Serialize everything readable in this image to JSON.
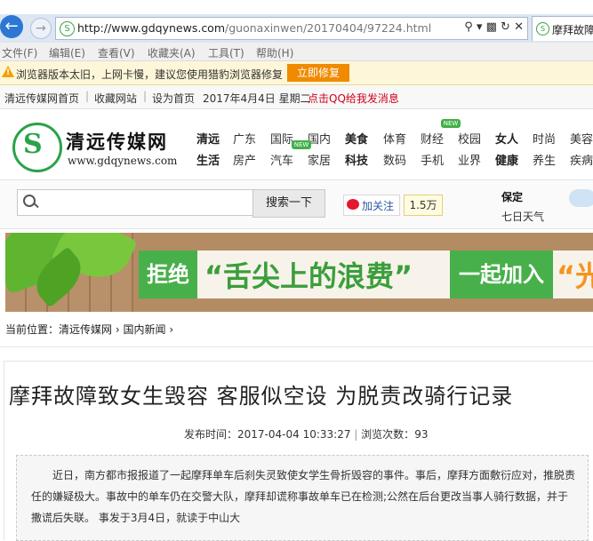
{
  "browser": {
    "url_host": "http://www.gdqynews.com",
    "url_path": "/guonaxinwen/20170404/97224.html",
    "tab_title": "摩拜故障",
    "menu": [
      "文件(F)",
      "编辑(E)",
      "查看(V)",
      "收藏夹(A)",
      "工具(T)",
      "帮助(H)"
    ],
    "warning_text": "浏览器版本太旧，上网卡慢，建议您使用猎豹浏览器修复",
    "repair_button": "立即修复"
  },
  "toplinks": {
    "home": "清远传媒网首页",
    "favorite": "收藏网站",
    "set_home": "设为首页",
    "date": "2017年4月4日 星期二",
    "qq_message": "点击QQ给我发消息"
  },
  "logo": {
    "name": "清远传媒网",
    "domain": "www.gdqynews.com"
  },
  "nav": {
    "row1": [
      "清远",
      "广东",
      "国际",
      "国内",
      "美食",
      "体育",
      "财经",
      "校园",
      "女人",
      "时尚",
      "美容"
    ],
    "row2": [
      "生活",
      "房产",
      "汽车",
      "家居",
      "科技",
      "数码",
      "手机",
      "业界",
      "健康",
      "养生",
      "疾病"
    ],
    "new_tag": "NEW"
  },
  "search": {
    "button": "搜索一下",
    "weibo_follow": "加关注",
    "followers": "1.5万",
    "weather_city": "保定",
    "weather_label": "七日天气"
  },
  "banner": {
    "refuse": "拒绝",
    "slogan": "“舌尖上的浪费”",
    "join": "一起加入",
    "guang": "“光"
  },
  "breadcrumb": {
    "label": "当前位置：",
    "site": "清远传媒网",
    "section": "国内新闻"
  },
  "article": {
    "title": "摩拜故障致女生毁容 客服似空设 为脱责改骑行记录",
    "publish_label": "发布时间：",
    "publish_time": "2017-04-04 10:33:27",
    "views_label": "浏览次数：",
    "views": "93",
    "summary": "近日，南方都市报报道了一起摩拜单车后刹失灵致使女学生骨折毁容的事件。事后，摩拜方面敷衍应对，推脱责任的嫌疑极大。事故中的单车仍在交警大队，摩拜却谎称事故单车已在检测;公然在后台更改当事人骑行数据，并于撒谎后失联。 事发于3月4日，就读于中山大"
  }
}
